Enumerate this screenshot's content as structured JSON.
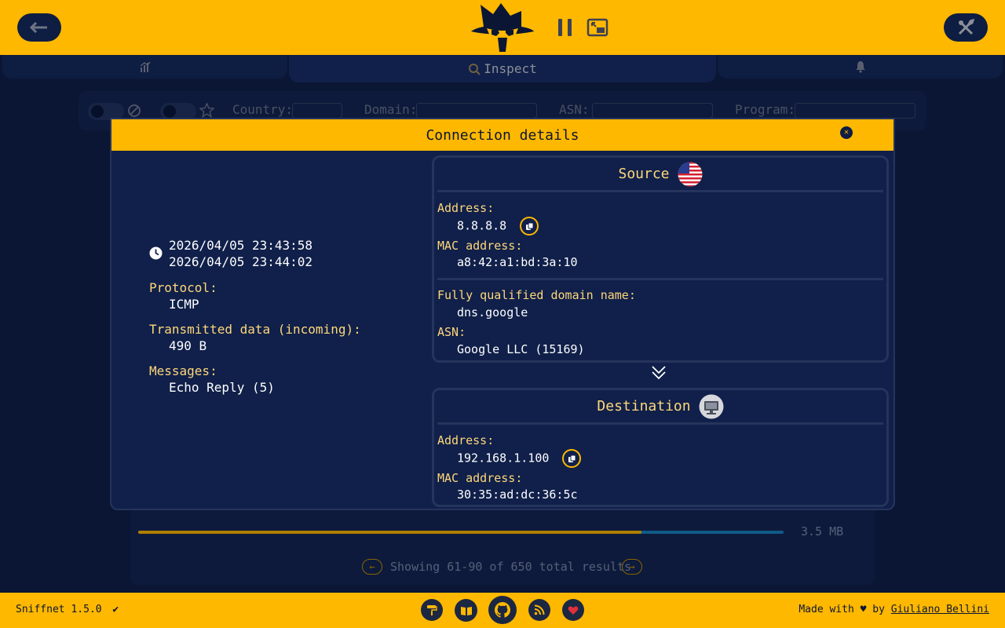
{
  "tabs": {
    "overview_icon": "chart-icon",
    "inspect_label": "Inspect",
    "notifications_icon": "bell-icon"
  },
  "filters": {
    "country_label": "Country:",
    "domain_label": "Domain:",
    "asn_label": "ASN:",
    "program_label": "Program:"
  },
  "table": {
    "total_size": "3.5 MB",
    "pagination": "Showing 61-90 of 650 total results",
    "progress_incoming": 0.78
  },
  "modal": {
    "title": "Connection details",
    "start_time": "2026/04/05 23:43:58",
    "end_time": "2026/04/05 23:44:02",
    "protocol_label": "Protocol:",
    "protocol": "ICMP",
    "transmitted_label": "Transmitted data (incoming):",
    "transmitted": "490 B",
    "messages_label": "Messages:",
    "messages": "Echo Reply (5)",
    "source": {
      "title": "Source",
      "address_label": "Address:",
      "address": "8.8.8.8",
      "mac_label": "MAC address:",
      "mac": "a8:42:a1:bd:3a:10",
      "fqdn_label": "Fully qualified domain name:",
      "fqdn": "dns.google",
      "asn_label": "ASN:",
      "asn": "Google LLC (15169)"
    },
    "destination": {
      "title": "Destination",
      "address_label": "Address:",
      "address": "192.168.1.100",
      "mac_label": "MAC address:",
      "mac": "30:35:ad:dc:36:5c"
    }
  },
  "footer": {
    "version": "Sniffnet 1.5.0",
    "made_with": "Made with",
    "by": "by",
    "author": "Giuliano Bellini"
  },
  "colors": {
    "accent": "#ffb800",
    "background": "#0a1633",
    "panel": "#10204a",
    "label": "#ffd77a"
  }
}
